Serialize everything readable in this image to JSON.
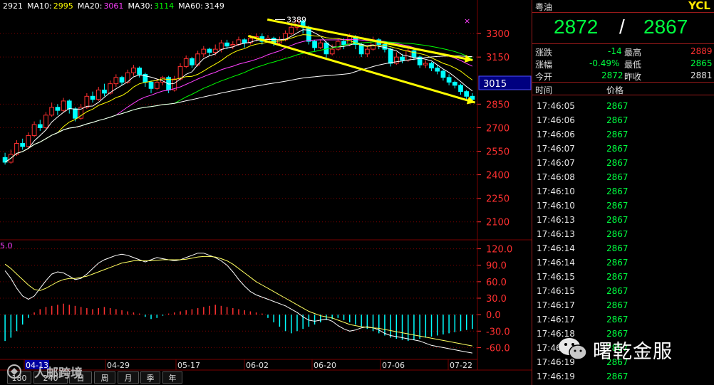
{
  "ma_legend": [
    {
      "label": "2921",
      "color": "#ffffff"
    },
    {
      "label": "MA10:",
      "color": "#ffffff"
    },
    {
      "label": "2995",
      "color": "#ffff00"
    },
    {
      "label": "MA20:",
      "color": "#ffffff"
    },
    {
      "label": "3061",
      "color": "#ff40ff"
    },
    {
      "label": "MA30:",
      "color": "#ffffff"
    },
    {
      "label": "3114",
      "color": "#00ff00"
    },
    {
      "label": "MA60:",
      "color": "#ffffff"
    },
    {
      "label": "3149",
      "color": "#ffffff"
    }
  ],
  "chart_data": [
    {
      "type": "candlestick",
      "y_ticks": [
        3300,
        3150,
        2850,
        2700,
        2550,
        2400,
        2250,
        2100
      ],
      "ylim": [
        1990,
        3450
      ],
      "x_date_labels": [
        "04-13",
        "04-29",
        "05-17",
        "06-02",
        "06-20",
        "07-06",
        "07-22"
      ],
      "peak_annotation": "3389",
      "current_price_label": "3015",
      "trend_channel": {
        "upper": [
          [
            0.56,
            3389
          ],
          [
            0.99,
            3130
          ]
        ],
        "lower": [
          [
            0.52,
            3285
          ],
          [
            0.995,
            2860
          ]
        ]
      },
      "candles": [
        [
          2510,
          2480,
          2540,
          2465
        ],
        [
          2480,
          2530,
          2560,
          2470
        ],
        [
          2530,
          2600,
          2620,
          2520
        ],
        [
          2600,
          2580,
          2630,
          2560
        ],
        [
          2580,
          2650,
          2670,
          2570
        ],
        [
          2650,
          2720,
          2740,
          2640
        ],
        [
          2720,
          2700,
          2750,
          2680
        ],
        [
          2700,
          2780,
          2800,
          2690
        ],
        [
          2780,
          2830,
          2860,
          2770
        ],
        [
          2830,
          2810,
          2850,
          2780
        ],
        [
          2810,
          2870,
          2890,
          2800
        ],
        [
          2870,
          2820,
          2880,
          2790
        ],
        [
          2820,
          2760,
          2830,
          2740
        ],
        [
          2760,
          2830,
          2850,
          2750
        ],
        [
          2830,
          2900,
          2920,
          2820
        ],
        [
          2900,
          2880,
          2930,
          2860
        ],
        [
          2880,
          2940,
          2960,
          2870
        ],
        [
          2940,
          2920,
          2980,
          2900
        ],
        [
          2920,
          2980,
          3000,
          2910
        ],
        [
          2980,
          3020,
          3040,
          2960
        ],
        [
          3020,
          2990,
          3030,
          2970
        ],
        [
          2990,
          3050,
          3070,
          2980
        ],
        [
          3050,
          3080,
          3100,
          3030
        ],
        [
          3080,
          3040,
          3090,
          3020
        ],
        [
          3040,
          2990,
          3050,
          2960
        ],
        [
          2990,
          2950,
          3000,
          2920
        ],
        [
          2950,
          2990,
          3010,
          2940
        ],
        [
          2990,
          3020,
          3030,
          2970
        ],
        [
          3020,
          2940,
          3030,
          2920
        ],
        [
          2940,
          3010,
          3030,
          2930
        ],
        [
          3010,
          3090,
          3110,
          3000
        ],
        [
          3090,
          3140,
          3160,
          3080
        ],
        [
          3140,
          3100,
          3150,
          3080
        ],
        [
          3100,
          3170,
          3190,
          3090
        ],
        [
          3170,
          3200,
          3220,
          3150
        ],
        [
          3200,
          3180,
          3210,
          3160
        ],
        [
          3180,
          3200,
          3230,
          3160
        ],
        [
          3200,
          3240,
          3260,
          3180
        ],
        [
          3240,
          3220,
          3260,
          3200
        ],
        [
          3220,
          3230,
          3250,
          3200
        ],
        [
          3230,
          3260,
          3280,
          3220
        ],
        [
          3260,
          3240,
          3270,
          3210
        ],
        [
          3240,
          3270,
          3290,
          3230
        ],
        [
          3270,
          3280,
          3300,
          3250
        ],
        [
          3280,
          3250,
          3300,
          3230
        ],
        [
          3250,
          3270,
          3290,
          3240
        ],
        [
          3270,
          3240,
          3280,
          3220
        ],
        [
          3240,
          3260,
          3280,
          3230
        ],
        [
          3260,
          3300,
          3320,
          3250
        ],
        [
          3300,
          3340,
          3370,
          3290
        ],
        [
          3340,
          3380,
          3389,
          3320
        ],
        [
          3380,
          3340,
          3385,
          3300
        ],
        [
          3340,
          3250,
          3350,
          3230
        ],
        [
          3250,
          3210,
          3260,
          3190
        ],
        [
          3210,
          3240,
          3260,
          3200
        ],
        [
          3240,
          3170,
          3250,
          3140
        ],
        [
          3170,
          3200,
          3230,
          3160
        ],
        [
          3200,
          3250,
          3270,
          3190
        ],
        [
          3250,
          3230,
          3270,
          3200
        ],
        [
          3230,
          3280,
          3300,
          3220
        ],
        [
          3280,
          3230,
          3290,
          3200
        ],
        [
          3230,
          3170,
          3240,
          3150
        ],
        [
          3170,
          3200,
          3220,
          3150
        ],
        [
          3200,
          3260,
          3280,
          3190
        ],
        [
          3260,
          3230,
          3270,
          3200
        ],
        [
          3230,
          3200,
          3250,
          3180
        ],
        [
          3200,
          3110,
          3210,
          3090
        ],
        [
          3110,
          3150,
          3180,
          3100
        ],
        [
          3150,
          3130,
          3170,
          3110
        ],
        [
          3130,
          3190,
          3210,
          3120
        ],
        [
          3190,
          3150,
          3200,
          3130
        ],
        [
          3150,
          3100,
          3160,
          3080
        ],
        [
          3100,
          3110,
          3130,
          3080
        ],
        [
          3110,
          3080,
          3120,
          3060
        ],
        [
          3080,
          3060,
          3100,
          3040
        ],
        [
          3060,
          3020,
          3070,
          3000
        ],
        [
          3020,
          2990,
          3040,
          2970
        ],
        [
          2990,
          2970,
          3000,
          2950
        ],
        [
          2970,
          2930,
          2980,
          2910
        ],
        [
          2930,
          2900,
          2940,
          2880
        ],
        [
          2900,
          2880,
          2920,
          2860
        ]
      ]
    },
    {
      "type": "bar+line",
      "title_fragment": "5.0",
      "y_ticks": [
        120.0,
        90.0,
        60.0,
        30.0,
        0.0,
        -30.0,
        -60.0
      ],
      "ylim": [
        -75,
        135
      ],
      "histogram": [
        -48,
        -42,
        -30,
        -18,
        -6,
        4,
        10,
        14,
        16,
        18,
        20,
        18,
        16,
        14,
        12,
        10,
        12,
        14,
        12,
        10,
        8,
        6,
        4,
        2,
        -4,
        -8,
        -6,
        -2,
        2,
        4,
        6,
        8,
        10,
        12,
        14,
        16,
        18,
        16,
        14,
        12,
        10,
        8,
        6,
        4,
        2,
        -6,
        -14,
        -22,
        -30,
        -34,
        -30,
        -26,
        -22,
        -18,
        -14,
        -10,
        -8,
        -6,
        -10,
        -14,
        -18,
        -22,
        -26,
        -30,
        -34,
        -38,
        -42,
        -44,
        -46,
        -48,
        -46,
        -44,
        -42,
        -40,
        -38,
        -36,
        -34,
        -32,
        -30,
        -28,
        -26
      ],
      "dif": [
        80,
        66,
        48,
        34,
        28,
        34,
        48,
        62,
        74,
        78,
        76,
        70,
        64,
        66,
        74,
        84,
        94,
        100,
        104,
        108,
        110,
        108,
        104,
        100,
        96,
        100,
        104,
        102,
        100,
        98,
        100,
        104,
        108,
        112,
        112,
        108,
        104,
        98,
        90,
        78,
        64,
        52,
        42,
        36,
        32,
        28,
        24,
        20,
        16,
        10,
        4,
        -4,
        -10,
        -12,
        -10,
        -8,
        -12,
        -20,
        -26,
        -30,
        -28,
        -24,
        -22,
        -24,
        -28,
        -34,
        -38,
        -40,
        -42,
        -44,
        -46,
        -48,
        -52,
        -56,
        -58,
        -60,
        -62,
        -64,
        -66,
        -68,
        -70
      ],
      "dea": [
        92,
        84,
        74,
        64,
        54,
        46,
        44,
        48,
        54,
        60,
        64,
        66,
        66,
        68,
        70,
        74,
        78,
        82,
        86,
        90,
        94,
        96,
        98,
        98,
        98,
        98,
        99,
        100,
        100,
        100,
        100,
        101,
        103,
        105,
        106,
        106,
        105,
        102,
        98,
        92,
        84,
        76,
        68,
        60,
        54,
        48,
        42,
        36,
        30,
        24,
        18,
        12,
        6,
        2,
        -2,
        -4,
        -6,
        -10,
        -14,
        -18,
        -20,
        -22,
        -23,
        -24,
        -25,
        -27,
        -29,
        -31,
        -33,
        -35,
        -37,
        -39,
        -41,
        -43,
        -45,
        -47,
        -49,
        -51,
        -53,
        -55,
        -57
      ]
    }
  ],
  "quote": {
    "name": "粤油",
    "code": "YCL",
    "price_a": "2872",
    "sep": "/",
    "price_b": "2867",
    "change_label": "涨跌",
    "change_value": "-14",
    "high_label": "最高",
    "high_value": "2889",
    "pct_label": "涨幅",
    "pct_value": "-0.49%",
    "low_label": "最低",
    "low_value": "2865",
    "open_label": "今开",
    "open_value": "2872",
    "prev_label": "昨收",
    "prev_value": "2881",
    "col_time": "时间",
    "col_price": "价格",
    "ticks": [
      {
        "t": "17:46:05",
        "p": "2867"
      },
      {
        "t": "17:46:06",
        "p": "2867"
      },
      {
        "t": "17:46:06",
        "p": "2867"
      },
      {
        "t": "17:46:07",
        "p": "2867"
      },
      {
        "t": "17:46:07",
        "p": "2867"
      },
      {
        "t": "17:46:08",
        "p": "2867"
      },
      {
        "t": "17:46:10",
        "p": "2867"
      },
      {
        "t": "17:46:10",
        "p": "2867"
      },
      {
        "t": "17:46:13",
        "p": "2867"
      },
      {
        "t": "17:46:13",
        "p": "2867"
      },
      {
        "t": "17:46:14",
        "p": "2867"
      },
      {
        "t": "17:46:14",
        "p": "2867"
      },
      {
        "t": "17:46:15",
        "p": "2867"
      },
      {
        "t": "17:46:15",
        "p": "2867"
      },
      {
        "t": "17:46:17",
        "p": "2867"
      },
      {
        "t": "17:46:17",
        "p": "2867"
      },
      {
        "t": "17:46:18",
        "p": "2867"
      },
      {
        "t": "17:46:18",
        "p": "2867"
      },
      {
        "t": "17:46:19",
        "p": "2867"
      },
      {
        "t": "17:46:19",
        "p": "2867"
      }
    ]
  },
  "period_buttons": [
    "180",
    "240",
    "日",
    "周",
    "月",
    "季",
    "年"
  ],
  "watermark": "曙乾金服",
  "corner_watermark": "人邮跨境",
  "colors": {
    "up": "#ff3030",
    "down": "#00ffff",
    "grid": "#7a0000",
    "axis": "#ff3030"
  }
}
